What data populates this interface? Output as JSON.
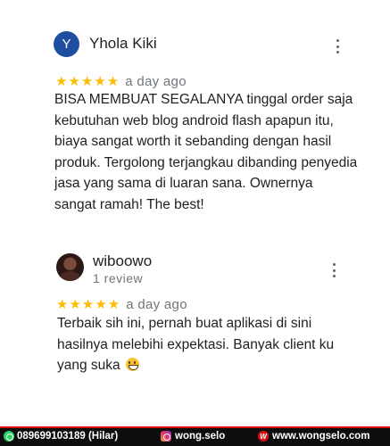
{
  "reviews": [
    {
      "avatar_letter": "Y",
      "avatar_color": "#1f4da0",
      "author": "Yhola Kiki",
      "stars": "★★★★★",
      "rating": 5,
      "time": "a day ago",
      "text": "BISA MEMBUAT SEGALANYA tinggal order saja kebutuhan web blog android flash apapun itu, biaya sangat worth it sebanding dengan hasil produk. Tergolong terjangkau dibanding penyedia jasa yang sama di luaran sana. Ownernya sangat ramah! The best!",
      "more_icon": "more-vert-icon"
    },
    {
      "author": "wiboowo",
      "subtitle": "1 review",
      "stars": "★★★★★",
      "rating": 5,
      "time": "a day ago",
      "text": "Terbaik sih ini, pernah buat aplikasi di sini hasilnya melebihi expektasi. Banyak client ku yang suka",
      "emoji": "grinning-face-emoji",
      "more_icon": "more-vert-icon"
    }
  ],
  "footer": {
    "whatsapp": "089699103189 (Hilar)",
    "instagram": "wong.selo",
    "website": "www.wongselo.com",
    "accent_color": "#d90f0f",
    "icons": [
      "whatsapp-icon",
      "instagram-icon",
      "website-icon"
    ],
    "website_icon_glyph": "W"
  },
  "colors": {
    "star": "#fbbc04",
    "muted_text": "#70757a"
  }
}
